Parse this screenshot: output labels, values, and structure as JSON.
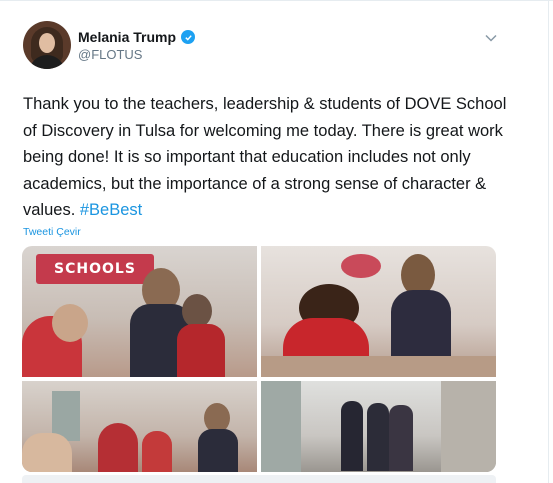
{
  "author": {
    "display_name": "Melania Trump",
    "handle": "@FLOTUS",
    "verified": true
  },
  "tweet": {
    "text": "Thank you to the teachers, leadership & students of DOVE School of Discovery in Tulsa for welcoming me today. There is great work being done! It is so important that education includes not only academics, but the importance of a strong sense of character & values. ",
    "hashtag": "#BeBest",
    "translate_label": "Tweeti Çevir"
  },
  "media": {
    "photo1_sign": "SCHOOLS"
  },
  "icons": {
    "verified": "verified-badge-icon",
    "menu": "chevron-down-icon"
  },
  "colors": {
    "link": "#1b95e0",
    "verified": "#1da1f2",
    "text": "#14171a",
    "secondary": "#657786"
  }
}
